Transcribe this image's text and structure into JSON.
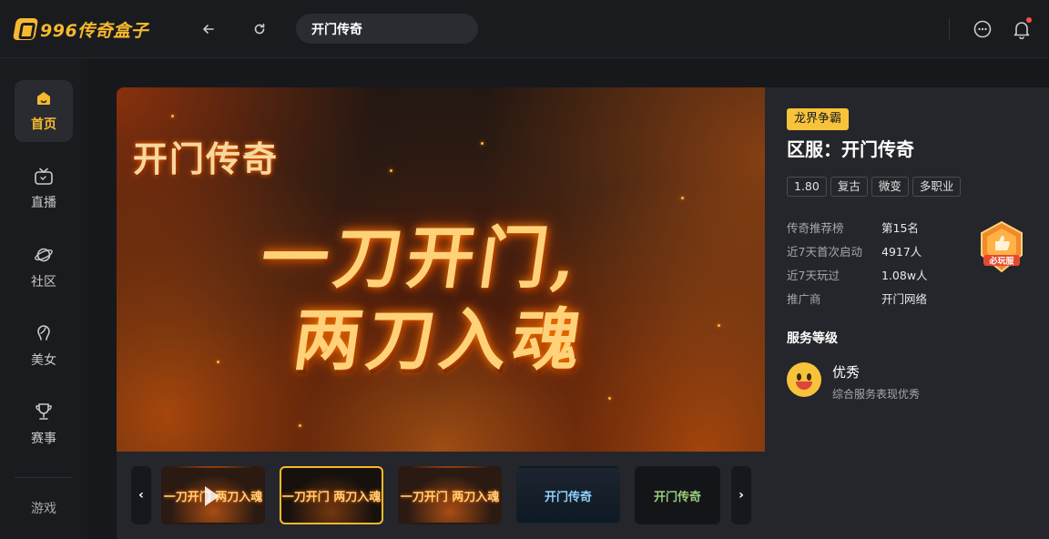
{
  "app": {
    "logo_text": "996传奇盒子"
  },
  "search": {
    "value": "开门传奇"
  },
  "sidebar": {
    "items": [
      {
        "label": "首页",
        "icon": "home-icon"
      },
      {
        "label": "直播",
        "icon": "tv-icon"
      },
      {
        "label": "社区",
        "icon": "planet-icon"
      },
      {
        "label": "美女",
        "icon": "beauty-icon"
      },
      {
        "label": "赛事",
        "icon": "trophy-icon"
      }
    ],
    "bottom_label": "游戏"
  },
  "hero": {
    "logo_text": "开门传奇",
    "line1": "一刀开门,",
    "line2": "两刀入魂"
  },
  "thumbnails": [
    {
      "caption": "一刀开门 两刀入魂",
      "style": "video"
    },
    {
      "caption": "一刀开门 两刀入魂",
      "style": "active"
    },
    {
      "caption": "一刀开门 两刀入魂",
      "style": "fire"
    },
    {
      "caption": "开门传奇",
      "style": "blue"
    },
    {
      "caption": "开门传奇",
      "style": "dark"
    }
  ],
  "panel": {
    "tag": "龙界争霸",
    "title": "区服：开门传奇",
    "chips": [
      "1.80",
      "复古",
      "微变",
      "多职业"
    ],
    "stats": [
      {
        "key": "传奇推荐榜",
        "value": "第15名"
      },
      {
        "key": "近7天首次启动",
        "value": "4917人"
      },
      {
        "key": "近7天玩过",
        "value": "1.08w人"
      },
      {
        "key": "推广商",
        "value": "开门网络"
      }
    ],
    "badge_label": "必玩服",
    "service_title": "服务等级",
    "service_level": "优秀",
    "service_desc": "综合服务表现优秀"
  },
  "colors": {
    "accent": "#f7b92d",
    "panel_bg": "#25262b",
    "page_bg": "#17181c"
  }
}
